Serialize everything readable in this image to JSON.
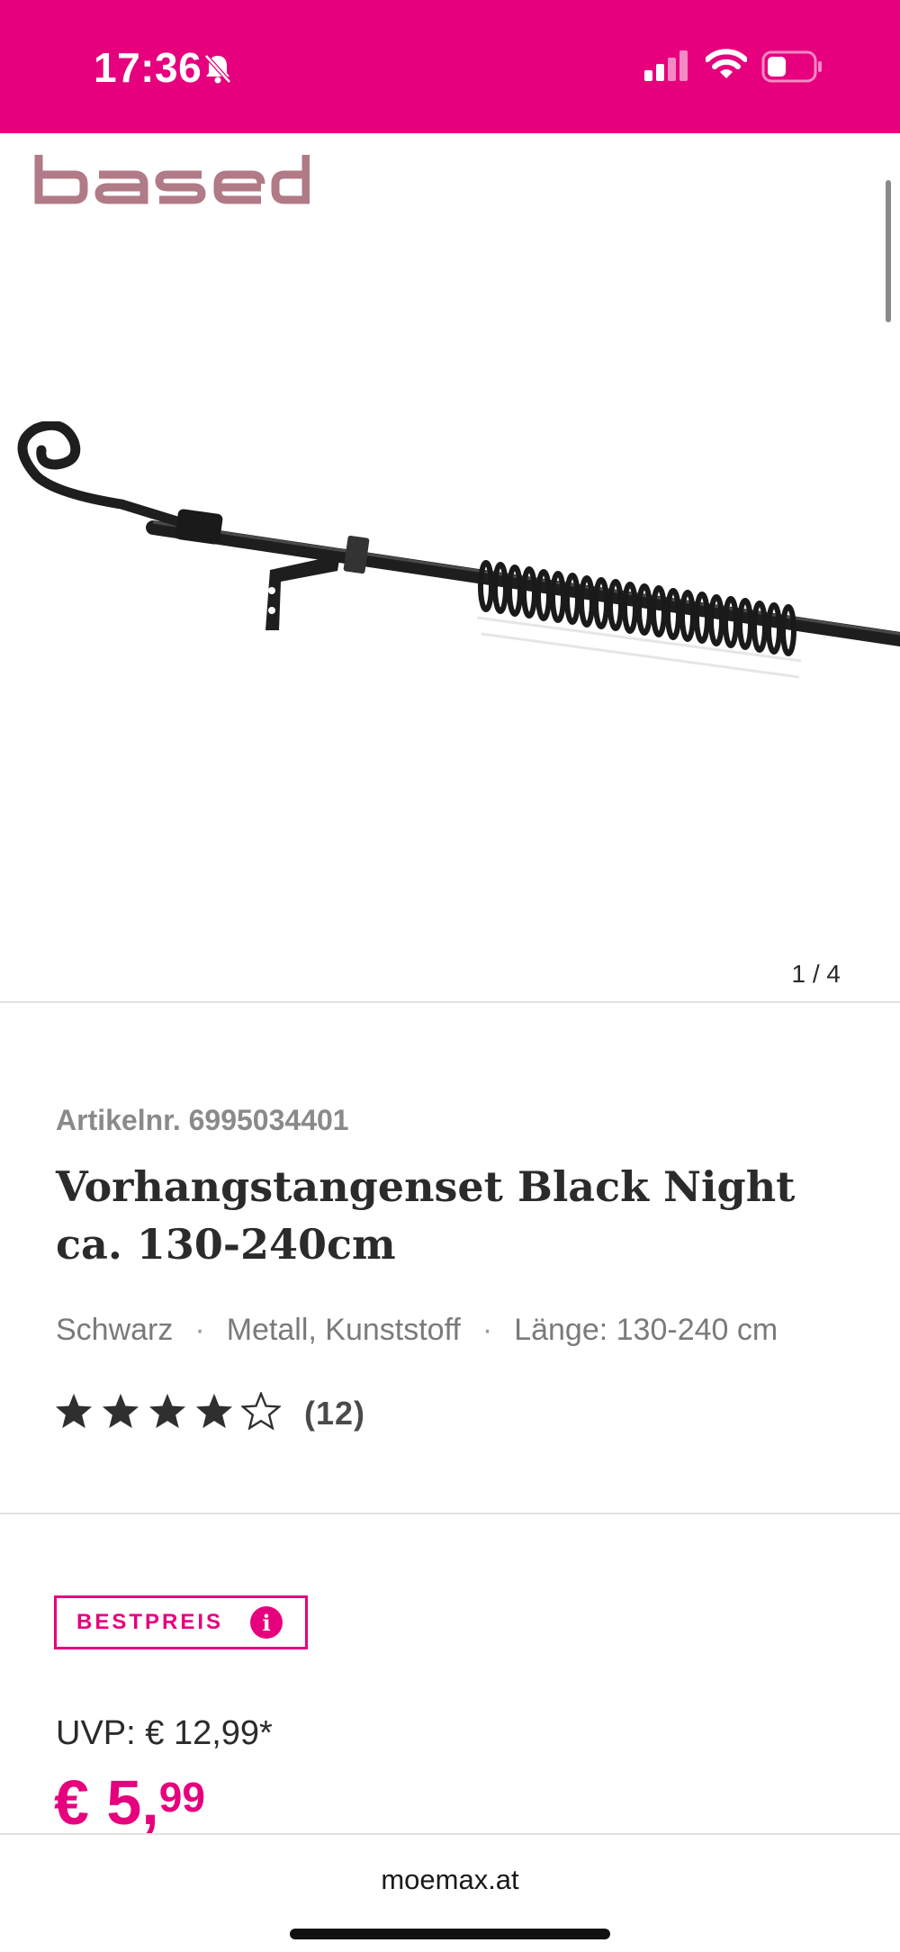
{
  "status_bar": {
    "time": "17:36",
    "background": "#e6007e",
    "icons": [
      "bell-slash-icon",
      "signal-icon",
      "wifi-icon",
      "battery-icon"
    ]
  },
  "gallery": {
    "brand": "based",
    "image": "curtain-rod-product-image",
    "counter": "1 / 4"
  },
  "product": {
    "article_number": "Artikelnr. 6995034401",
    "title_bold": "Vorhangstangenset",
    "title_rest": " Black Night ca. 130-240cm",
    "attributes": [
      "Schwarz",
      "Metall, Kunststoff",
      "Länge: 130-240 cm"
    ],
    "attribute_separator": "·",
    "rating": 4,
    "rating_max": 5,
    "review_count": "(12)"
  },
  "pricing": {
    "badge": "BESTPREIS",
    "info_symbol": "i",
    "uvp": "UVP: € 12,99*",
    "price_main": "€ 5,",
    "price_cents": "99",
    "accent_color": "#e6007e"
  },
  "browser": {
    "url": "moemax.at"
  }
}
